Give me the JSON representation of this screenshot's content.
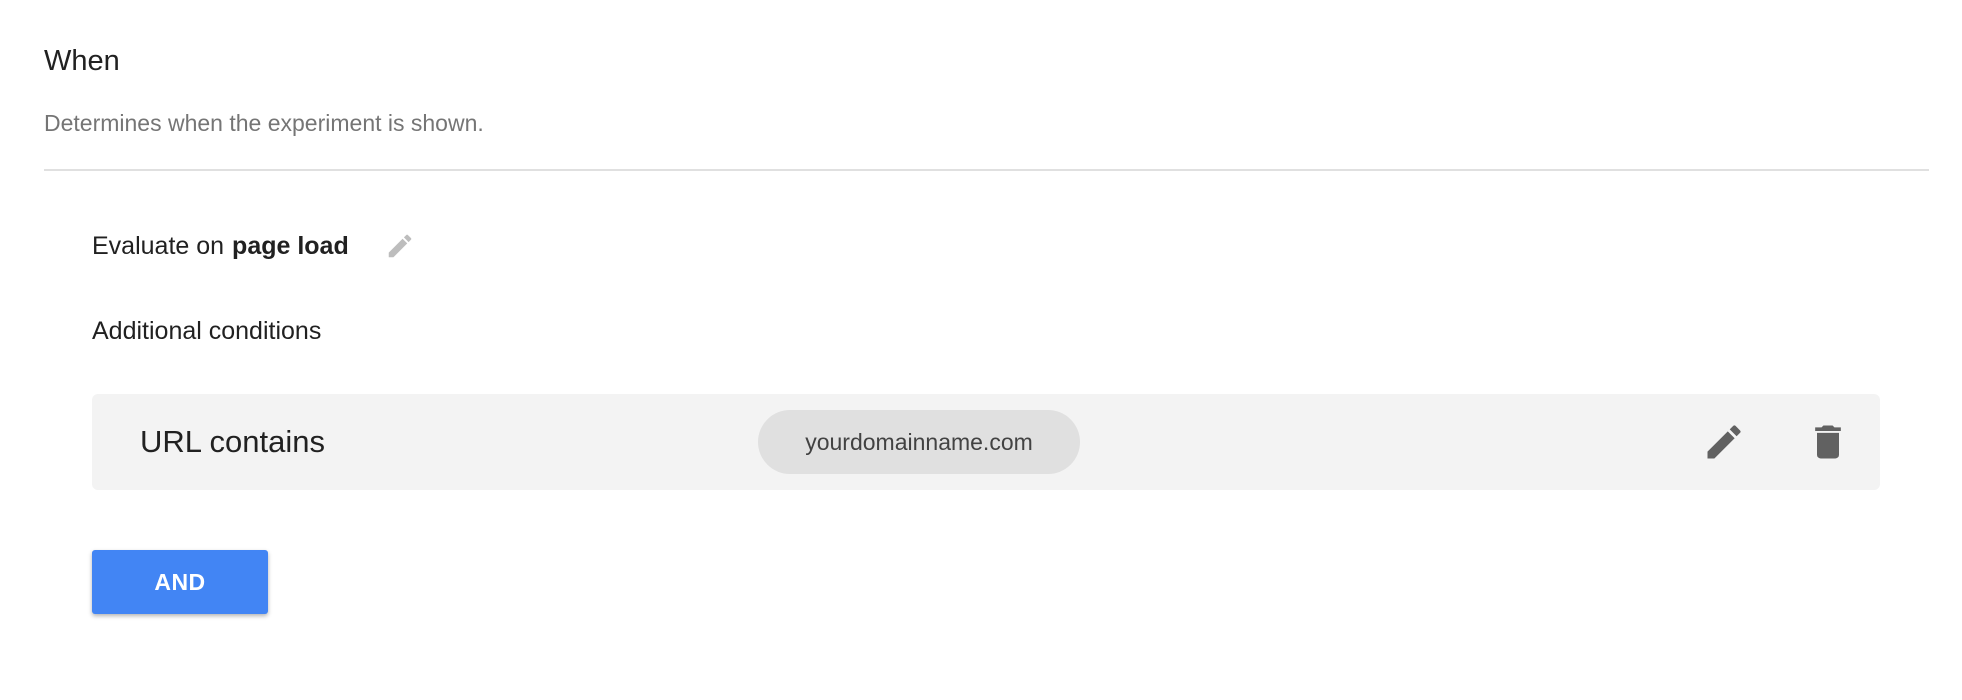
{
  "section": {
    "title": "When",
    "subtitle": "Determines when the experiment is shown."
  },
  "evaluate": {
    "prefix": "Evaluate on",
    "value": "page load",
    "edit_icon": "pencil-icon"
  },
  "additional": {
    "label": "Additional conditions"
  },
  "conditions": [
    {
      "type": "URL contains",
      "value": "yourdomainname.com",
      "edit_icon": "pencil-icon",
      "delete_icon": "trash-icon"
    }
  ],
  "actions": {
    "and_label": "AND"
  },
  "colors": {
    "accent": "#4285f4",
    "icon_dark": "#616161",
    "icon_light": "#bdbdbd",
    "card_bg": "#f3f3f3",
    "chip_bg": "#e0e0e0"
  }
}
